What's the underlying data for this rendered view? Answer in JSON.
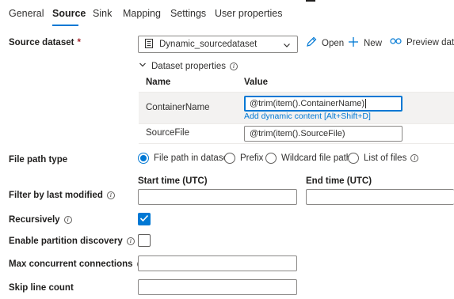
{
  "tabs": [
    {
      "label": "General"
    },
    {
      "label": "Source"
    },
    {
      "label": "Sink"
    },
    {
      "label": "Mapping"
    },
    {
      "label": "Settings"
    },
    {
      "label": "User properties"
    }
  ],
  "active_tab": "Source",
  "accent_color": "#0078d4",
  "source_dataset": {
    "label": "Source dataset",
    "required_mark": "*",
    "value": "Dynamic_sourcedataset",
    "actions": {
      "open": "Open",
      "new": "New",
      "preview": "Preview data"
    }
  },
  "dataset_properties": {
    "title": "Dataset properties",
    "col_name": "Name",
    "col_value": "Value",
    "rows": [
      {
        "name": "ContainerName",
        "value": "@trim(item().ContainerName)"
      },
      {
        "name": "SourceFile",
        "value": "@trim(item().SourceFile)"
      }
    ],
    "dynamic_link": "Add dynamic content [Alt+Shift+D]"
  },
  "file_path_type": {
    "label": "File path type",
    "options": [
      "File path in dataset",
      "Prefix",
      "Wildcard file path",
      "List of files"
    ],
    "selected": "File path in dataset"
  },
  "filter": {
    "label": "Filter by last modified",
    "start_label": "Start time (UTC)",
    "end_label": "End time (UTC)",
    "start_value": "",
    "end_value": ""
  },
  "recursively": {
    "label": "Recursively",
    "checked": true
  },
  "partition_discovery": {
    "label": "Enable partition discovery",
    "checked": false
  },
  "max_connections": {
    "label": "Max concurrent connections",
    "value": ""
  },
  "skip_line_count": {
    "label": "Skip line count",
    "value": ""
  }
}
